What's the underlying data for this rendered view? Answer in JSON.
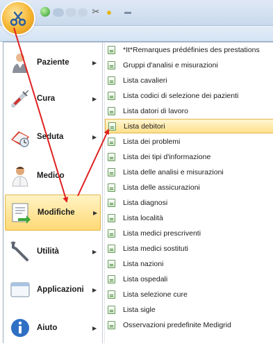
{
  "left_menu": [
    {
      "label": "Paziente",
      "icon": "patient-icon",
      "highlighted": false
    },
    {
      "label": "Cura",
      "icon": "syringe-icon",
      "highlighted": false
    },
    {
      "label": "Seduta",
      "icon": "calendar-icon",
      "highlighted": false
    },
    {
      "label": "Medico",
      "icon": "doctor-icon",
      "highlighted": false
    },
    {
      "label": "Modifiche",
      "icon": "edit-list-icon",
      "highlighted": true
    },
    {
      "label": "Utilità",
      "icon": "wrench-icon",
      "highlighted": false
    },
    {
      "label": "Applicazioni",
      "icon": "window-icon",
      "highlighted": false
    },
    {
      "label": "Aiuto",
      "icon": "info-icon",
      "highlighted": false
    }
  ],
  "submenu": [
    {
      "label": "*It*Remarques prédéfinies des prestations"
    },
    {
      "label": "Gruppi d'analisi e misurazioni"
    },
    {
      "label": "Lista cavalieri"
    },
    {
      "label": "Lista codici di selezione dei pazienti"
    },
    {
      "label": "Lista datori di lavoro"
    },
    {
      "label": "Lista debitori",
      "highlighted": true
    },
    {
      "label": "Lista dei problemi"
    },
    {
      "label": "Lista dei tipi d'informazione"
    },
    {
      "label": "Lista delle analisi e misurazioni"
    },
    {
      "label": "Lista delle assicurazioni"
    },
    {
      "label": "Lista diagnosi"
    },
    {
      "label": "Lista località"
    },
    {
      "label": "Lista medici prescriventi"
    },
    {
      "label": "Lista medici sostituti"
    },
    {
      "label": "Lista nazioni"
    },
    {
      "label": "Lista ospedali"
    },
    {
      "label": "Lista selezione cure"
    },
    {
      "label": "Lista sigle"
    },
    {
      "label": "Osservazioni predefinite Medigrid"
    }
  ],
  "colors": {
    "highlight": "#ffd975",
    "arrow": "#e02020"
  }
}
